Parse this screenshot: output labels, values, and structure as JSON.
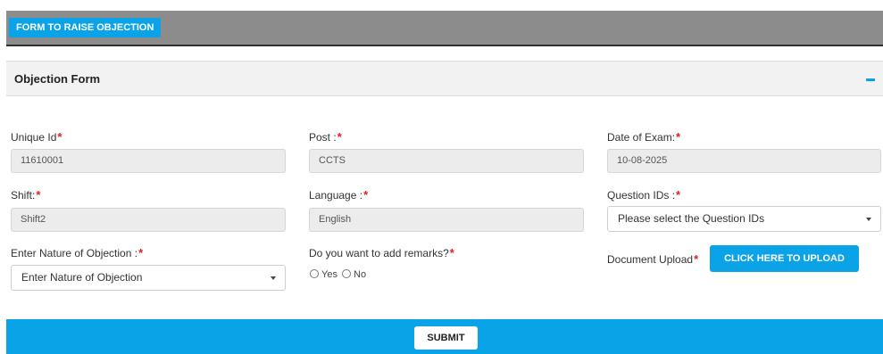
{
  "header": {
    "button_label": "FORM TO RAISE OBJECTION"
  },
  "panel": {
    "title": "Objection Form",
    "collapse_icon": "minus-icon"
  },
  "fields": {
    "unique_id": {
      "label": "Unique Id",
      "value": "11610001"
    },
    "post": {
      "label": "Post :",
      "value": "CCTS"
    },
    "date_of_exam": {
      "label": "Date of Exam:",
      "value": "10-08-2025"
    },
    "shift": {
      "label": "Shift:",
      "value": "Shift2"
    },
    "language": {
      "label": "Language :",
      "value": "English"
    },
    "question_ids": {
      "label": "Question IDs :",
      "selected": "Please select the Question IDs"
    },
    "nature_of_objection": {
      "label": "Enter Nature of Objection :",
      "selected": "Enter Nature of Objection"
    },
    "remarks": {
      "label": "Do you want to add remarks?",
      "options": [
        "Yes",
        "No"
      ]
    },
    "document_upload": {
      "label": "Document Upload",
      "button_label": "CLICK HERE TO UPLOAD"
    }
  },
  "required_marker": "*",
  "footer": {
    "submit_label": "SUBMIT"
  },
  "colors": {
    "accent": "#0aa3e8",
    "required": "#e02020",
    "header_bg": "#8c8c8c"
  }
}
